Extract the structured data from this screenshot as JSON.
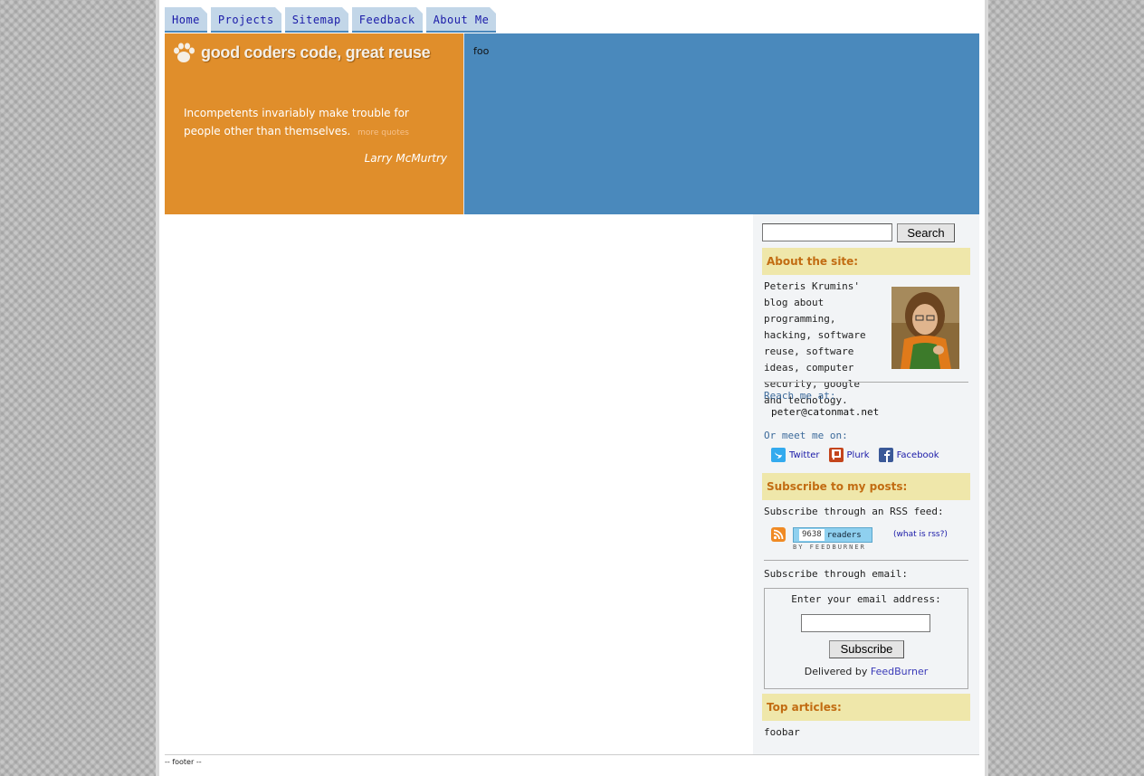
{
  "nav": {
    "tabs": [
      {
        "label": "Home"
      },
      {
        "label": "Projects"
      },
      {
        "label": "Sitemap"
      },
      {
        "label": "Feedback"
      },
      {
        "label": "About Me"
      }
    ]
  },
  "header": {
    "logo_text": "good coders code, great reuse",
    "quote": "Incompetents invariably make trouble for people other than themselves.",
    "more_quotes": "more quotes",
    "author": "Larry McMurtry",
    "right_text": "foo"
  },
  "sidebar": {
    "search_button": "Search",
    "about_heading": "About the site:",
    "about_text": "Peteris Krumins' blog about programming, hacking, software reuse, software ideas, computer security, google and techology.",
    "reach_label": "Reach me at:",
    "email": "peter@catonmat.net",
    "meet_label": "Or meet me on:",
    "social": {
      "twitter": "Twitter",
      "plurk": "Plurk",
      "facebook": "Facebook"
    },
    "subscribe_heading": "Subscribe to my posts:",
    "rss_label": "Subscribe through an RSS feed:",
    "feed_count": "9638",
    "feed_readers": "readers",
    "feedburner_tag": "BY FEEDBURNER",
    "what_is_rss": "(what is rss?)",
    "email_sub_label": "Subscribe through email:",
    "enter_email": "Enter your email address:",
    "subscribe_button": "Subscribe",
    "delivered_by": "Delivered by",
    "feedburner_link": "FeedBurner",
    "top_heading": "Top articles:",
    "top_item": "foobar"
  },
  "footer": {
    "text": "-- footer --"
  },
  "colors": {
    "header_orange": "#e08e2b",
    "header_blue": "#4a89bc",
    "section_head_bg": "#efe7aa",
    "section_head_text": "#c26c12",
    "tab_bg": "#c2d6e8"
  }
}
